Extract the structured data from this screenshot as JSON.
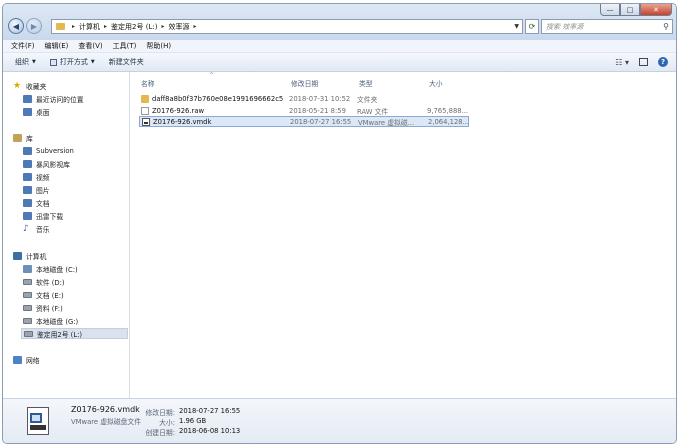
{
  "window": {
    "controls": {
      "minimize": "—",
      "maximize": "□",
      "close": "✕"
    }
  },
  "address": {
    "crumbs": [
      "计算机",
      "鉴定用2号 (L:)",
      "效率源"
    ],
    "search_placeholder": "搜索 效率源"
  },
  "menu": [
    "文件(F)",
    "编辑(E)",
    "查看(V)",
    "工具(T)",
    "帮助(H)"
  ],
  "toolbar": {
    "organize": "组织",
    "open_with": "打开方式",
    "new_folder": "新建文件夹"
  },
  "navpane": {
    "favorites": {
      "title": "收藏夹",
      "items": [
        "最近访问的位置",
        "桌面"
      ]
    },
    "libraries": {
      "title": "库",
      "items": [
        "Subversion",
        "暴风影视库",
        "视频",
        "图片",
        "文档",
        "迅雷下载",
        "音乐"
      ]
    },
    "computer": {
      "title": "计算机",
      "items": [
        "本地磁盘 (C:)",
        "软件 (D:)",
        "文档 (E:)",
        "资料 (F:)",
        "本地磁盘 (G:)",
        "鉴定用2号 (L:)"
      ]
    },
    "network": {
      "title": "网络"
    }
  },
  "columns": {
    "name": "名称",
    "date": "修改日期",
    "type": "类型",
    "size": "大小"
  },
  "files": [
    {
      "name": "daff8a8b0f37b760e08e1991696662c5",
      "date": "2018-07-31 10:52",
      "type": "文件夹",
      "size": "",
      "icon": "folder-icon"
    },
    {
      "name": "Z0176-926.raw",
      "date": "2018-05-21 8:59",
      "type": "RAW 文件",
      "size": "9,765,888...",
      "icon": "document-icon"
    },
    {
      "name": "Z0176-926.vmdk",
      "date": "2018-07-27 16:55",
      "type": "VMware 虚拟磁...",
      "size": "2,064,128...",
      "icon": "vmdk-icon"
    }
  ],
  "details": {
    "name": "Z0176-926.vmdk",
    "type": "VMware 虚拟磁盘文件",
    "modified_label": "修改日期:",
    "modified_value": "2018-07-27 16:55",
    "size_label": "大小:",
    "size_value": "1.96 GB",
    "created_label": "创建日期:",
    "created_value": "2018-06-08 10:13"
  }
}
